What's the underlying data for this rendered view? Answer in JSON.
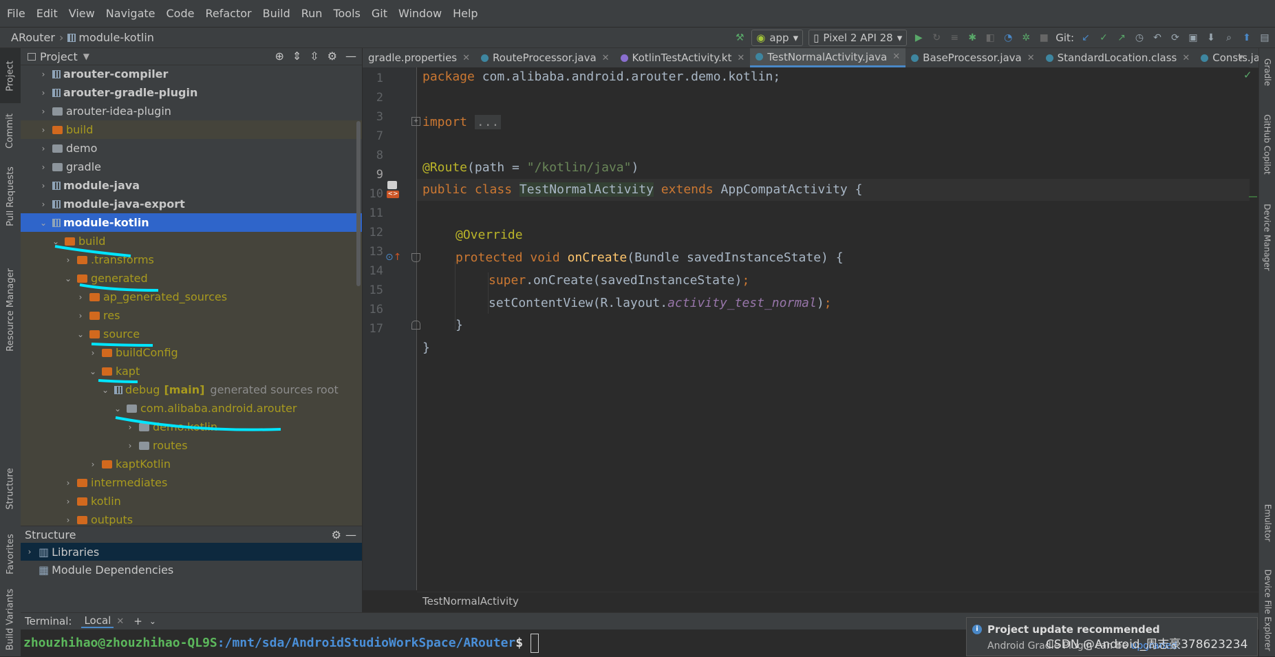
{
  "menu": [
    "File",
    "Edit",
    "View",
    "Navigate",
    "Code",
    "Refactor",
    "Build",
    "Run",
    "Tools",
    "Git",
    "Window",
    "Help"
  ],
  "breadcrumb": {
    "root": "ARouter",
    "module": "module-kotlin"
  },
  "toolbar": {
    "run_config": "app",
    "device": "Pixel 2 API 28",
    "git_label": "Git:"
  },
  "left_strip": [
    "Project",
    "Commit",
    "Pull Requests",
    "Resource Manager",
    "Structure",
    "Favorites",
    "Build Variants"
  ],
  "right_strip": [
    "Gradle",
    "GitHub Copilot",
    "Device Manager",
    "Emulator",
    "Device File Explorer"
  ],
  "project_panel": {
    "title": "Project"
  },
  "tree": [
    {
      "label": "arouter-compiler",
      "bold": true,
      "icon": "module",
      "indent": 1,
      "chev": "right",
      "style": "norm"
    },
    {
      "label": "arouter-gradle-plugin",
      "bold": true,
      "icon": "module",
      "indent": 1,
      "chev": "right",
      "style": "norm"
    },
    {
      "label": "arouter-idea-plugin",
      "bold": false,
      "icon": "folder-gray",
      "indent": 1,
      "chev": "right",
      "style": "norm"
    },
    {
      "label": "build",
      "bold": false,
      "icon": "folder-orange",
      "indent": 1,
      "chev": "right",
      "style": "olive",
      "excluded": true
    },
    {
      "label": "demo",
      "bold": false,
      "icon": "folder-gray",
      "indent": 1,
      "chev": "right",
      "style": "norm"
    },
    {
      "label": "gradle",
      "bold": false,
      "icon": "folder-gray",
      "indent": 1,
      "chev": "right",
      "style": "norm"
    },
    {
      "label": "module-java",
      "bold": true,
      "icon": "module",
      "indent": 1,
      "chev": "right",
      "style": "norm"
    },
    {
      "label": "module-java-export",
      "bold": true,
      "icon": "module",
      "indent": 1,
      "chev": "right",
      "style": "norm"
    },
    {
      "label": "module-kotlin",
      "bold": true,
      "icon": "module",
      "indent": 1,
      "chev": "down",
      "style": "norm",
      "selected": true
    },
    {
      "label": "build",
      "bold": false,
      "icon": "folder-orange",
      "indent": 2,
      "chev": "down",
      "style": "olive",
      "excluded": true
    },
    {
      "label": ".transforms",
      "bold": false,
      "icon": "folder-orange",
      "indent": 3,
      "chev": "right",
      "style": "olive",
      "excluded": true
    },
    {
      "label": "generated",
      "bold": false,
      "icon": "folder-orange",
      "indent": 3,
      "chev": "down",
      "style": "olive",
      "excluded": true
    },
    {
      "label": "ap_generated_sources",
      "bold": false,
      "icon": "folder-orange",
      "indent": 4,
      "chev": "right",
      "style": "olive",
      "excluded": true
    },
    {
      "label": "res",
      "bold": false,
      "icon": "folder-orange",
      "indent": 4,
      "chev": "right",
      "style": "olive",
      "excluded": true
    },
    {
      "label": "source",
      "bold": false,
      "icon": "folder-orange",
      "indent": 4,
      "chev": "down",
      "style": "olive",
      "excluded": true
    },
    {
      "label": "buildConfig",
      "bold": false,
      "icon": "folder-orange",
      "indent": 5,
      "chev": "right",
      "style": "olive",
      "excluded": true
    },
    {
      "label": "kapt",
      "bold": false,
      "icon": "folder-orange",
      "indent": 5,
      "chev": "down",
      "style": "olive",
      "excluded": true
    },
    {
      "label": "debug",
      "suffix": "[main]",
      "note": "generated sources root",
      "bold": false,
      "icon": "module",
      "indent": 6,
      "chev": "down",
      "style": "olive",
      "excluded": true
    },
    {
      "label": "com.alibaba.android.arouter",
      "bold": false,
      "icon": "folder-pkg",
      "indent": 7,
      "chev": "down",
      "style": "olive",
      "excluded": true
    },
    {
      "label": "demo.kotlin",
      "bold": false,
      "icon": "folder-pkg",
      "indent": 8,
      "chev": "right",
      "style": "olive",
      "excluded": true
    },
    {
      "label": "routes",
      "bold": false,
      "icon": "folder-pkg",
      "indent": 8,
      "chev": "right",
      "style": "olive",
      "excluded": true
    },
    {
      "label": "kaptKotlin",
      "bold": false,
      "icon": "folder-orange",
      "indent": 5,
      "chev": "right",
      "style": "olive",
      "excluded": true
    },
    {
      "label": "intermediates",
      "bold": false,
      "icon": "folder-orange",
      "indent": 3,
      "chev": "right",
      "style": "olive",
      "excluded": true
    },
    {
      "label": "kotlin",
      "bold": false,
      "icon": "folder-orange",
      "indent": 3,
      "chev": "right",
      "style": "olive",
      "excluded": true
    },
    {
      "label": "outputs",
      "bold": false,
      "icon": "folder-orange",
      "indent": 3,
      "chev": "right",
      "style": "olive",
      "excluded": true
    }
  ],
  "structure_panel": {
    "title": "Structure",
    "items": [
      "Libraries",
      "Module Dependencies"
    ]
  },
  "tabs": [
    {
      "label": "gradle.properties",
      "kind": "none",
      "active": false
    },
    {
      "label": "RouteProcessor.java",
      "kind": "class",
      "active": false
    },
    {
      "label": "KotlinTestActivity.kt",
      "kind": "kotlin",
      "active": false
    },
    {
      "label": "TestNormalActivity.java",
      "kind": "class",
      "active": true
    },
    {
      "label": "BaseProcessor.java",
      "kind": "class",
      "active": false
    },
    {
      "label": "StandardLocation.class",
      "kind": "class",
      "active": false
    },
    {
      "label": "Consts.java",
      "kind": "class",
      "active": false
    }
  ],
  "line_numbers": [
    "1",
    "2",
    "3",
    "7",
    "8",
    "9",
    "10",
    "11",
    "12",
    "13",
    "14",
    "15",
    "16",
    "17"
  ],
  "code": {
    "l1_kw": "package",
    "l1_rest": " com.alibaba.android.arouter.demo.kotlin;",
    "l3_kw": "import",
    "l3_fold": "...",
    "l8_ann": "@Route",
    "l8_a": "(path = ",
    "l8_str": "\"/kotlin/java\"",
    "l8_b": ")",
    "l9_kw1": "public class ",
    "l9_cls": "TestNormalActivity",
    "l9_kw2": " extends ",
    "l9_rest": "AppCompatActivity {",
    "l11_ann": "@Override",
    "l12_kw": "protected void ",
    "l12_fn": "onCreate",
    "l12_rest": "(Bundle savedInstanceState) {",
    "l13_kw": "super",
    "l13_rest": ".onCreate(savedInstanceState)",
    "l13_semi": ";",
    "l14_a": "setContentView(R.layout.",
    "l14_it": "activity_test_normal",
    "l14_b": ")",
    "l14_semi": ";",
    "l15": "}",
    "l16": "}"
  },
  "editor_breadcrumb": "TestNormalActivity",
  "terminal": {
    "title": "Terminal:",
    "tab": "Local",
    "user": "zhouzhihao@zhouzhihao-QL9S",
    "path": ":/mnt/sda/AndroidStudioWorkSpace/ARouter",
    "dollar": "$ "
  },
  "notification": {
    "title": "Project update recommended",
    "body": "Android Gradle Plugin can be ",
    "link": "upgraded."
  },
  "watermark": "CSDN @Android_周志豪378623234",
  "colors": {
    "accent": "#2f65ca",
    "highlight_ink": "#00e5ff"
  }
}
